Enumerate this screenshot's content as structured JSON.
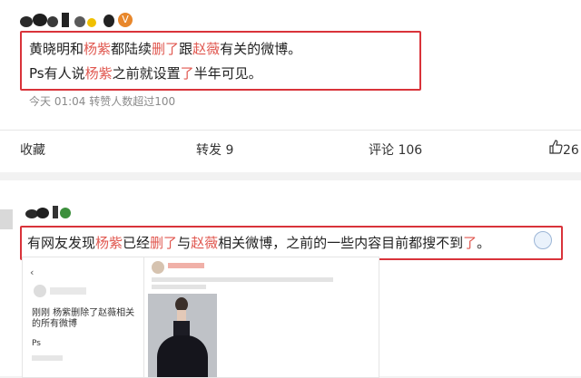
{
  "post1": {
    "line1": {
      "a": "黄晓明和",
      "b": "杨紫",
      "c": "都陆续",
      "d": "删了",
      "e": "跟",
      "f": "赵薇",
      "g": "有关的微博。"
    },
    "line2": {
      "a": "Ps有人说",
      "b": "杨紫",
      "c": "之前就设置",
      "d": "了",
      "e": "半年可见。"
    },
    "meta": "今天 01:04 转赞人数超过100",
    "actions": {
      "collect": "收藏",
      "repost": "转发 9",
      "comment": "评论 106",
      "like_count": "26"
    }
  },
  "post2": {
    "line": {
      "a": "有网友发现",
      "b": "杨紫",
      "c": "已经",
      "d": "删了",
      "e": "与",
      "f": "赵薇",
      "g": "相关微博，之前的一些内容目前都搜不到",
      "h": "了",
      "i": "。"
    },
    "screenshot_left": {
      "text": "刚刚 杨紫删除了赵薇相关的所有微博",
      "ps": "Ps"
    }
  },
  "colors": {
    "highlight": "#e0574f",
    "box_border": "#d9333a"
  }
}
